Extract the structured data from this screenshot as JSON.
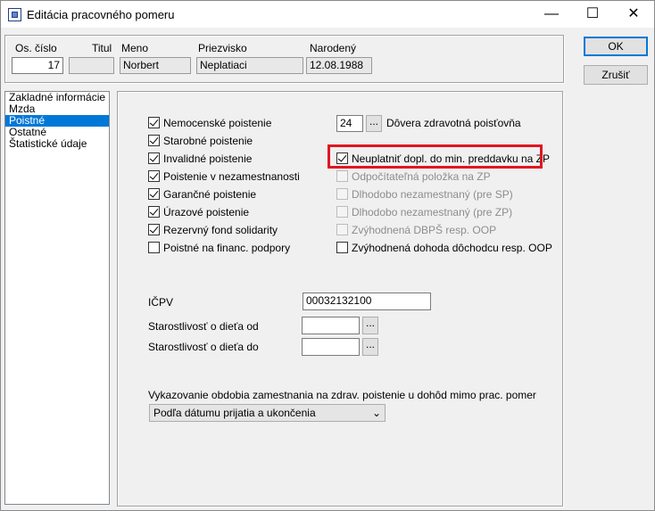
{
  "window": {
    "title": "Editácia pracovného pomeru",
    "controls": {
      "minimize": "—",
      "maximize": "☐",
      "close": "✕"
    }
  },
  "header": {
    "os_cislo_label": "Os. číslo",
    "titul_label": "Titul",
    "meno_label": "Meno",
    "priezvisko_label": "Priezvisko",
    "narodeny_label": "Narodený",
    "os_cislo_value": "17",
    "titul_value": "",
    "meno_value": "Norbert",
    "priezvisko_value": "Neplatiaci",
    "narodeny_value": "12.08.1988"
  },
  "buttons": {
    "ok": "OK",
    "cancel": "Zrušiť"
  },
  "sidebar": {
    "items": [
      {
        "label": "Zakladné informácie",
        "selected": false
      },
      {
        "label": "Mzda",
        "selected": false
      },
      {
        "label": "Poistné",
        "selected": true
      },
      {
        "label": "Ostatné",
        "selected": false
      },
      {
        "label": "Štatistické údaje",
        "selected": false
      }
    ]
  },
  "insurance_left": [
    {
      "label": "Nemocenské poistenie",
      "checked": true
    },
    {
      "label": "Starobné poistenie",
      "checked": true
    },
    {
      "label": "Invalidné poistenie",
      "checked": true
    },
    {
      "label": "Poistenie v nezamestnanosti",
      "checked": true
    },
    {
      "label": "Garančné poistenie",
      "checked": true
    },
    {
      "label": "Úrazové poistenie",
      "checked": true
    },
    {
      "label": "Rezervný fond solidarity",
      "checked": true
    },
    {
      "label": "Poistné na financ. podpory",
      "checked": false
    }
  ],
  "health_insurer": {
    "code": "24",
    "dots": "...",
    "name": "Dôvera zdravotná poisťovňa"
  },
  "insurance_right": [
    {
      "label": "Neuplatniť dopl. do min. preddavku na ZP",
      "checked": true,
      "disabled": false
    },
    {
      "label": "Odpočítateľná položka na ZP",
      "checked": false,
      "disabled": true
    },
    {
      "label": "Dlhodobo nezamestnaný (pre SP)",
      "checked": false,
      "disabled": true
    },
    {
      "label": "Dlhodobo nezamestnaný (pre ZP)",
      "checked": false,
      "disabled": true
    },
    {
      "label": "Zvýhodnená DBPŠ resp. OOP",
      "checked": false,
      "disabled": true
    },
    {
      "label": "Zvýhodnená dohoda dôchodcu resp. OOP",
      "checked": false,
      "disabled": false
    }
  ],
  "icpv": {
    "label": "IČPV",
    "value": "00032132100"
  },
  "care_from": {
    "label": "Starostlivosť o dieťa od",
    "value": "",
    "dots": "..."
  },
  "care_to": {
    "label": "Starostlivosť o dieťa do",
    "value": "",
    "dots": "..."
  },
  "reporting": {
    "label": "Vykazovanie obdobia zamestnania na zdrav. poistenie u dohôd mimo prac. pomer",
    "selected": "Podľa dátumu prijatia a ukončenia",
    "chevron": "⌄"
  },
  "colors": {
    "highlight": "#e0161f",
    "selection": "#0078d7"
  }
}
